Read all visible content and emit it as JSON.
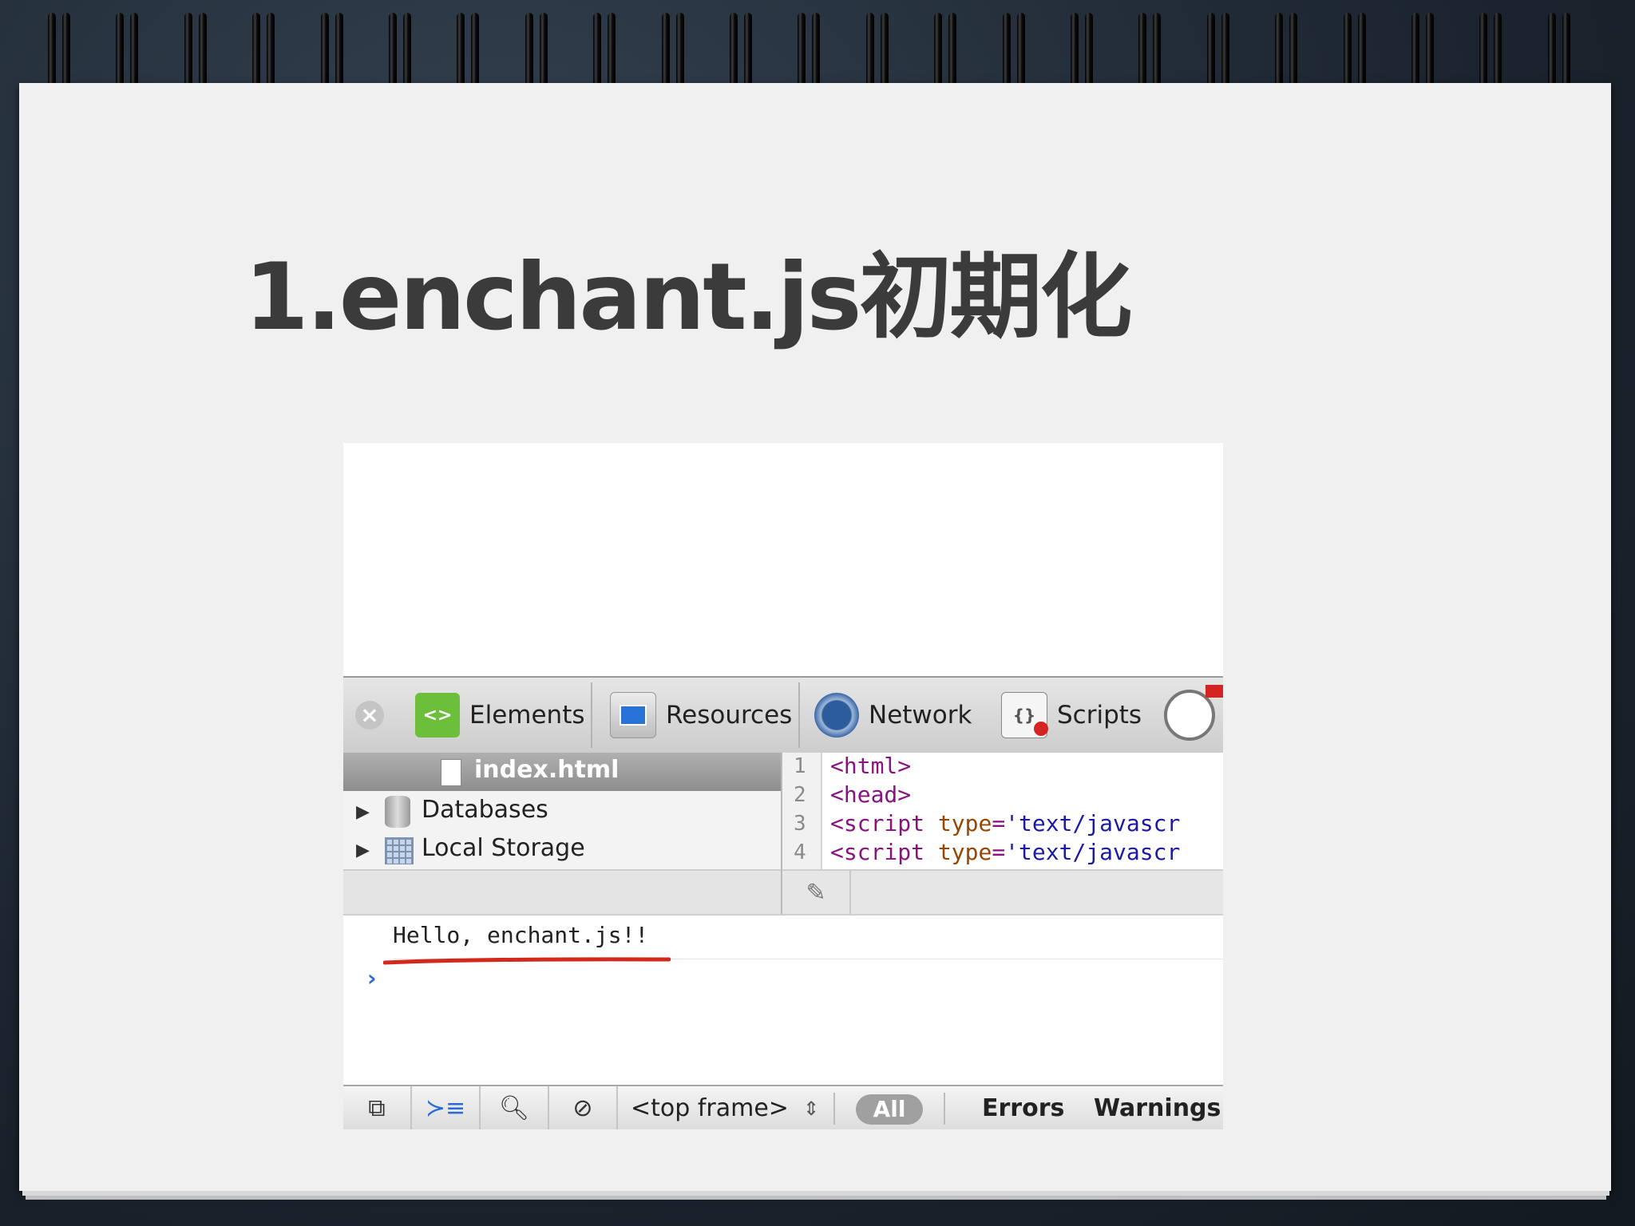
{
  "slide": {
    "title": "1.enchant.js初期化"
  },
  "devtools": {
    "tabs": [
      {
        "label": "Elements",
        "icon": "elements-icon"
      },
      {
        "label": "Resources",
        "icon": "resources-icon"
      },
      {
        "label": "Network",
        "icon": "network-icon"
      },
      {
        "label": "Scripts",
        "icon": "scripts-icon"
      }
    ],
    "tree": {
      "selected": "index.html",
      "items": [
        {
          "label": "Databases",
          "icon": "database-icon"
        },
        {
          "label": "Local Storage",
          "icon": "grid-icon"
        }
      ]
    },
    "source": {
      "line_numbers": [
        "1",
        "2",
        "3",
        "4"
      ],
      "lines": [
        {
          "tag": "<html>"
        },
        {
          "tag": "<head>"
        },
        {
          "tag": "<script",
          "attr": "type",
          "val": "'text/javascr"
        },
        {
          "tag": "<script",
          "attr": "type",
          "val": "'text/javascr"
        }
      ]
    },
    "console": {
      "message": "Hello, enchant.js!!",
      "prompt": "›"
    },
    "statusbar": {
      "frame": "<top frame>",
      "filters": {
        "all": "All",
        "errors": "Errors",
        "warnings": "Warnings"
      }
    }
  }
}
